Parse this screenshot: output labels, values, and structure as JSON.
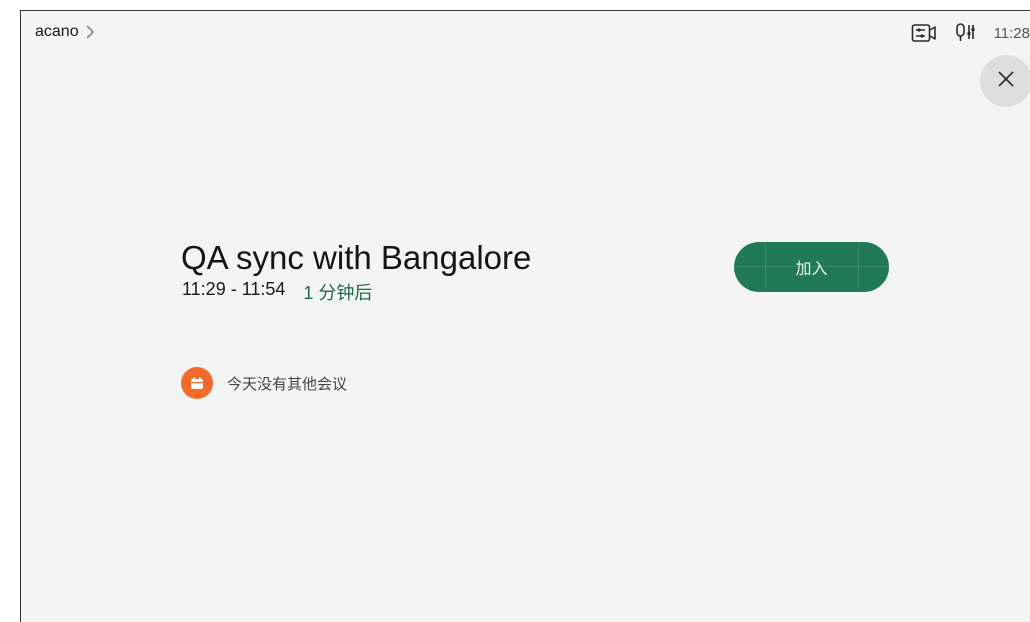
{
  "header": {
    "breadcrumb": "acano",
    "time": "11:28",
    "icons": [
      "camera-control-icon",
      "microphone-settings-icon"
    ]
  },
  "close": {
    "icon": "close-icon"
  },
  "meeting": {
    "title": "QA sync with Bangalore",
    "time_range": "11:29 - 11:54",
    "relative": "1 分钟后",
    "join_label": "加入"
  },
  "footer_note": {
    "icon": "calendar-icon",
    "text": "今天没有其他会议"
  },
  "colors": {
    "accent": "#1f7a55",
    "relative_text": "#1d6b4a",
    "calendar_badge": "#f26b2a",
    "background": "#f4f4f4"
  }
}
